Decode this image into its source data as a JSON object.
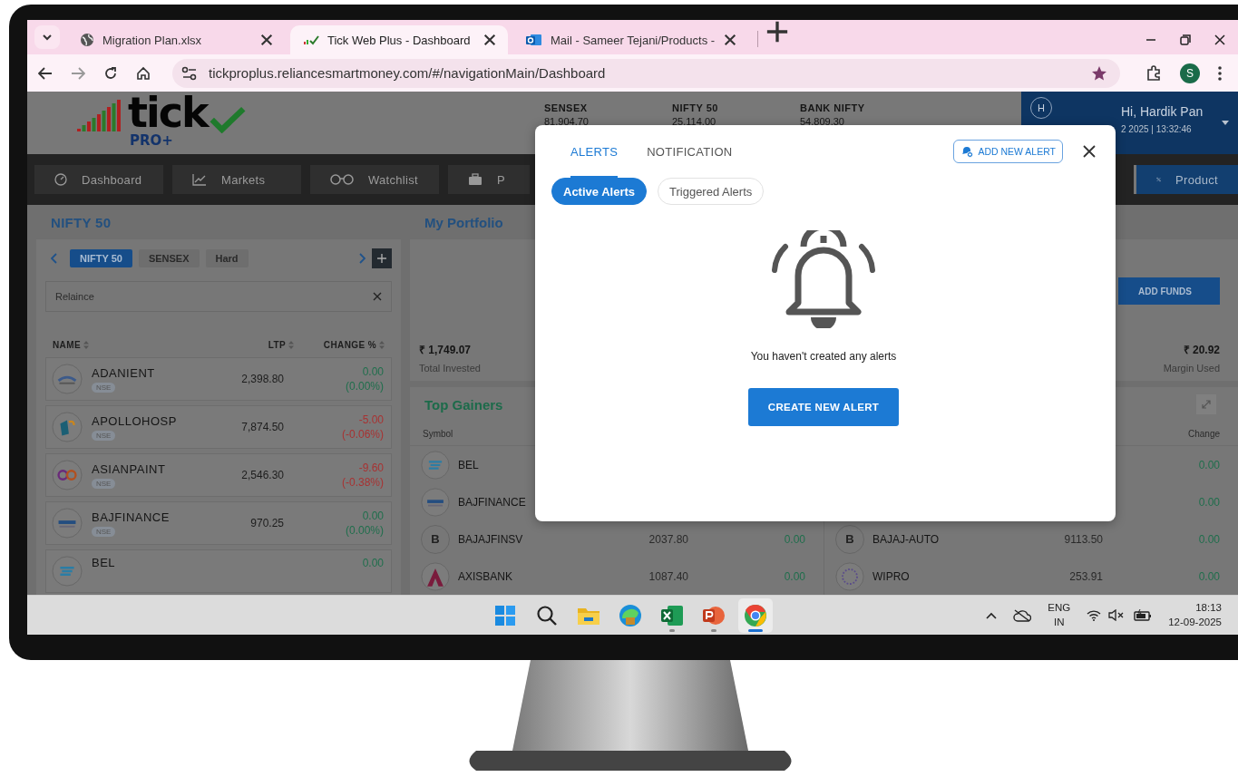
{
  "browser": {
    "tabs": [
      {
        "kind": "globe",
        "title": "Migration Plan.xlsx",
        "selected": false
      },
      {
        "kind": "site",
        "title": "Tick Web Plus - Dashboard",
        "selected": true
      },
      {
        "kind": "mail",
        "title": "Mail - Sameer Tejani/Products -",
        "selected": false
      }
    ],
    "url": "tickproplus.reliancesmartmoney.com/#/navigationMain/Dashboard",
    "profile": "S"
  },
  "header": {
    "logo": {
      "word": "tick",
      "badge": "PRO+"
    },
    "indices": [
      {
        "name": "SENSEX",
        "value": "81,904.70"
      },
      {
        "name": "NIFTY 50",
        "value": "25,114.00"
      },
      {
        "name": "BANK NIFTY",
        "value": "54,809.30"
      }
    ],
    "user": {
      "initial": "H",
      "greeting": "Hi, Hardik Pan",
      "timestamp": "2 2025 | 13:32:46"
    }
  },
  "nav": [
    {
      "kind": "dashboard",
      "label": "Dashboard",
      "selected": false
    },
    {
      "kind": "markets",
      "label": "Markets",
      "selected": false
    },
    {
      "kind": "watchlist",
      "label": "Watchlist",
      "selected": false
    },
    {
      "kind": "portfolio",
      "label": "P",
      "selected": false
    },
    {
      "kind": "products",
      "label": "Product",
      "selected": true
    }
  ],
  "watchlist": {
    "title": "NIFTY 50",
    "tabs": [
      {
        "label": "NIFTY 50",
        "selected": true
      },
      {
        "label": "SENSEX",
        "selected": false
      },
      {
        "label": "Hard",
        "selected": false
      }
    ],
    "search": {
      "value": "Relaince"
    },
    "columns": [
      "NAME",
      "LTP",
      "CHANGE %"
    ],
    "rows": [
      {
        "kind": "adani",
        "symbol": "ADANIENT",
        "exchange": "NSE",
        "ltp": "2,398.80",
        "change": "0.00",
        "change_pct": "(0.00%)",
        "negative": false
      },
      {
        "kind": "apollo",
        "symbol": "APOLLOHOSP",
        "exchange": "NSE",
        "ltp": "7,874.50",
        "change": "-5.00",
        "change_pct": "(-0.06%)",
        "negative": true
      },
      {
        "kind": "asian",
        "symbol": "ASIANPAINT",
        "exchange": "NSE",
        "ltp": "2,546.30",
        "change": "-9.60",
        "change_pct": "(-0.38%)",
        "negative": true
      },
      {
        "kind": "bajaj",
        "symbol": "BAJFINANCE",
        "exchange": "NSE",
        "ltp": "970.25",
        "change": "0.00",
        "change_pct": "(0.00%)",
        "negative": false
      },
      {
        "kind": "bel",
        "symbol": "BEL",
        "change": "0.00",
        "negative": false
      }
    ]
  },
  "portfolio": {
    "title": "My Portfolio",
    "add_funds": "ADD FUNDS",
    "stats": [
      {
        "value": "₹ 1,749.07",
        "label": "Total Invested"
      },
      {
        "value": "₹ 20.92",
        "label": "Margin Used"
      }
    ]
  },
  "gainers": {
    "title": "Top Gainers",
    "tables": [
      {
        "columns": [
          "Symbol"
        ],
        "rows": [
          {
            "kind": "bel",
            "symbol": "BEL"
          },
          {
            "kind": "bajaj",
            "symbol": "BAJFINANCE"
          },
          {
            "kind": "letter",
            "letter": "B",
            "symbol": "BAJAJFINSV",
            "ltp": "2037.80",
            "change": "0.00",
            "negative": false
          },
          {
            "kind": "axis",
            "symbol": "AXISBANK",
            "ltp": "1087.40",
            "change": "0.00",
            "negative": false
          }
        ]
      },
      {
        "columns": [
          "Change"
        ],
        "rows": [
          {
            "change": "0.00",
            "negative": false
          },
          {
            "change": "0.00",
            "negative": false
          },
          {
            "kind": "letter",
            "letter": "B",
            "symbol": "BAJAJ-AUTO",
            "ltp": "9113.50",
            "change": "0.00",
            "negative": false
          },
          {
            "kind": "wipro",
            "symbol": "WIPRO",
            "ltp": "253.91",
            "change": "0.00",
            "negative": false
          }
        ]
      }
    ]
  },
  "alerts_dialog": {
    "tabs": [
      {
        "label": "ALERTS",
        "selected": true
      },
      {
        "label": "NOTIFICATION",
        "selected": false
      }
    ],
    "add_button": "ADD NEW ALERT",
    "filters": [
      {
        "label": "Active Alerts",
        "selected": true
      },
      {
        "label": "Triggered Alerts",
        "selected": false
      }
    ],
    "empty_message": "You haven't created any alerts",
    "create_button": "CREATE NEW ALERT"
  },
  "taskbar": {
    "apps": [
      {
        "kind": "start",
        "running": false,
        "active": false
      },
      {
        "kind": "search",
        "running": false,
        "active": false
      },
      {
        "kind": "folder",
        "running": false,
        "active": false
      },
      {
        "kind": "edge",
        "running": false,
        "active": false
      },
      {
        "kind": "excel",
        "running": true,
        "active": false
      },
      {
        "kind": "powerpoint",
        "running": true,
        "active": false
      },
      {
        "kind": "chrome",
        "running": true,
        "active": true
      }
    ],
    "language": [
      "ENG",
      "IN"
    ],
    "time": "18:13",
    "date": "12-09-2025"
  }
}
